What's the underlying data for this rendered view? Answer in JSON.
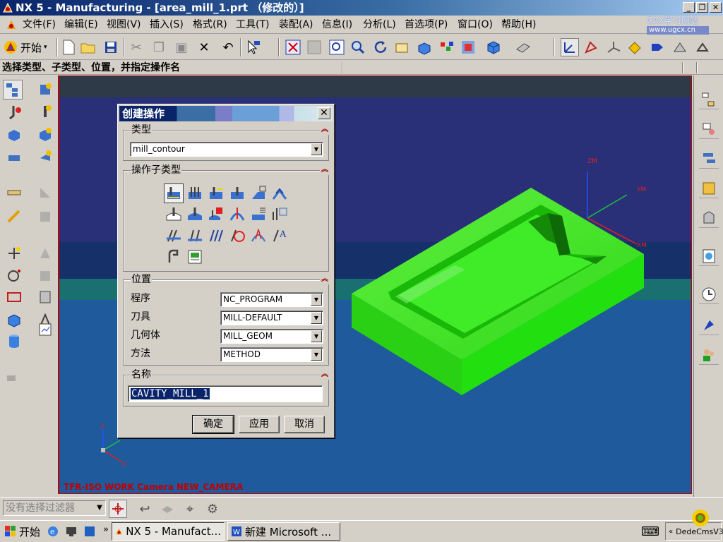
{
  "window": {
    "title": "NX 5 - Manufacturing - [area_mill_1.prt （修改的）]"
  },
  "menubar": {
    "items": [
      "文件(F)",
      "编辑(E)",
      "视图(V)",
      "插入(S)",
      "格式(R)",
      "工具(T)",
      "装配(A)",
      "信息(I)",
      "分析(L)",
      "首选项(P)",
      "窗口(O)",
      "帮助(H)"
    ]
  },
  "watermark": {
    "line1": "CAX学习网站",
    "line2": "www.ugcx.cn"
  },
  "toolbar": {
    "start_label": "开始"
  },
  "cue": {
    "text": "选择类型、子类型、位置，并指定操作名"
  },
  "viewport": {
    "label": "TFR-ISO WORK Camera NEW_CAMERA",
    "axes": {
      "zm": "ZM",
      "ym": "YM",
      "xm": "XM",
      "z": "Z",
      "y": "Y",
      "x": "X"
    },
    "colors": {
      "part": "#22e010",
      "background": "#1e5a9c"
    }
  },
  "dialog": {
    "title": "创建操作",
    "close_symbol": "✕",
    "type_group": {
      "label": "类型",
      "value": "mill_contour"
    },
    "subtype_group": {
      "label": "操作子类型"
    },
    "location_group": {
      "label": "位置",
      "fields": [
        {
          "label": "程序",
          "value": "NC_PROGRAM"
        },
        {
          "label": "刀具",
          "value": "MILL-DEFAULT"
        },
        {
          "label": "几何体",
          "value": "MILL_GEOM"
        },
        {
          "label": "方法",
          "value": "METHOD"
        }
      ]
    },
    "name_group": {
      "label": "名称",
      "value": "CAVITY_MILL_1"
    },
    "buttons": {
      "ok": "确定",
      "apply": "应用",
      "cancel": "取消"
    }
  },
  "statusbar": {
    "filter_placeholder": "没有选择过滤器"
  },
  "taskbar": {
    "start": "开始",
    "tasks": [
      "NX 5 - Manufact...",
      "新建 Microsoft ..."
    ],
    "tray_text": "DedeCmsV3"
  }
}
